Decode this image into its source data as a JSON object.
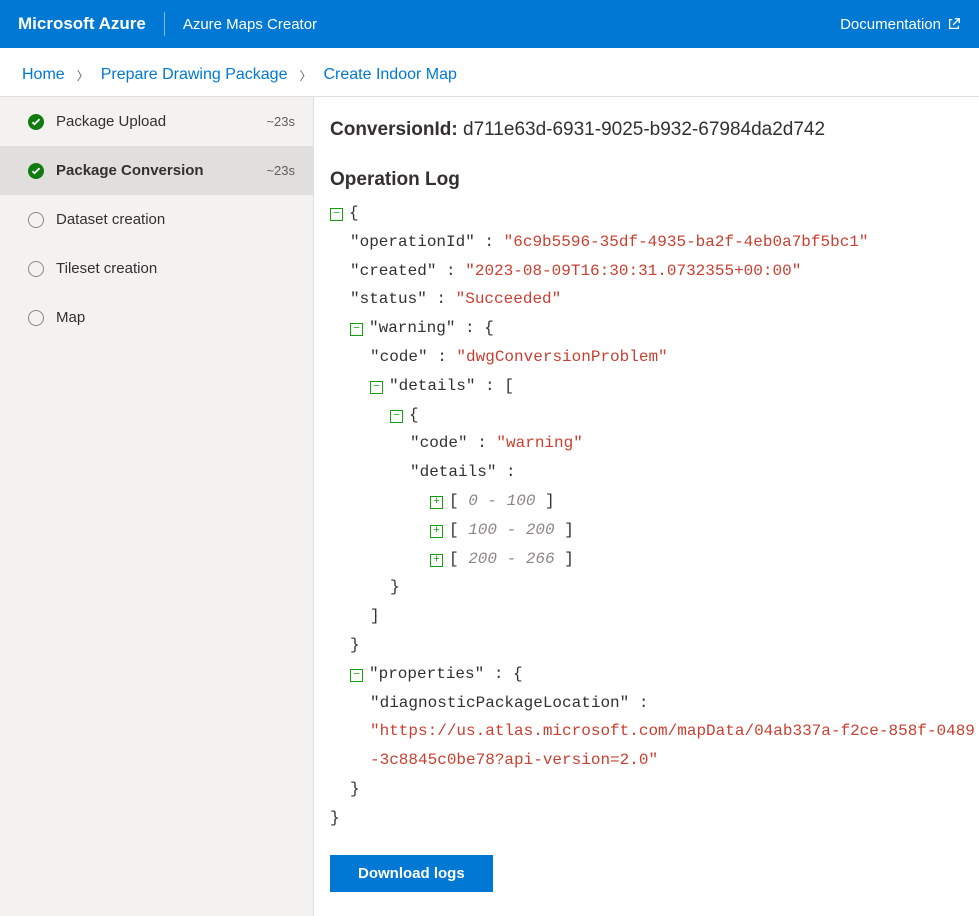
{
  "header": {
    "brand": "Microsoft Azure",
    "product": "Azure Maps Creator",
    "doc_link": "Documentation"
  },
  "breadcrumb": {
    "items": [
      "Home",
      "Prepare Drawing Package",
      "Create Indoor Map"
    ]
  },
  "sidebar": {
    "steps": [
      {
        "label": "Package Upload",
        "status": "done",
        "time": "~23s"
      },
      {
        "label": "Package Conversion",
        "status": "done",
        "time": "~23s",
        "active": true
      },
      {
        "label": "Dataset creation",
        "status": "pending",
        "time": ""
      },
      {
        "label": "Tileset creation",
        "status": "pending",
        "time": ""
      },
      {
        "label": "Map",
        "status": "pending",
        "time": ""
      }
    ]
  },
  "main": {
    "conversion_label": "ConversionId",
    "conversion_id": "d711e63d-6931-9025-b932-67984da2d742",
    "oplog_title": "Operation Log",
    "download_button": "Download logs"
  },
  "operation_log": {
    "operationId_key": "\"operationId\"",
    "operationId_val": "\"6c9b5596-35df-4935-ba2f-4eb0a7bf5bc1\"",
    "created_key": "\"created\"",
    "created_val": "\"2023-08-09T16:30:31.0732355+00:00\"",
    "status_key": "\"status\"",
    "status_val": "\"Succeeded\"",
    "warning_key": "\"warning\"",
    "code_key": "\"code\"",
    "code_val": "\"dwgConversionProblem\"",
    "details_key": "\"details\"",
    "inner_code_val": "\"warning\"",
    "ranges": [
      "0 - 100",
      "100 - 200",
      "200 - 266"
    ],
    "properties_key": "\"properties\"",
    "diag_key": "\"diagnosticPackageLocation\"",
    "diag_val": "\"https://us.atlas.microsoft.com/mapData/04ab337a-f2ce-858f-0489-3c8845c0be78?api-version=2.0\""
  }
}
